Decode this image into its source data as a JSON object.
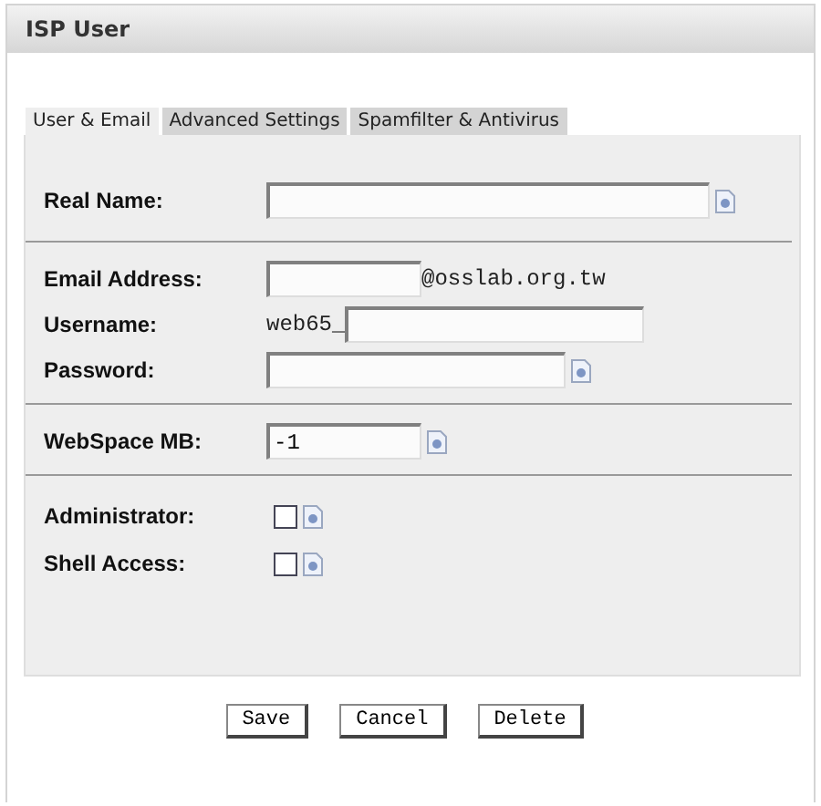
{
  "window": {
    "title": "ISP User"
  },
  "tabs": [
    {
      "label": "User & Email",
      "selected": true
    },
    {
      "label": "Advanced Settings",
      "selected": false
    },
    {
      "label": "Spamfilter & Antivirus",
      "selected": false
    }
  ],
  "sections": [
    {
      "rows": [
        {
          "kind": "text",
          "label": "Real Name:",
          "value": "",
          "help": true
        }
      ]
    },
    {
      "rows": [
        {
          "kind": "suffix",
          "label": "Email Address:",
          "value": "",
          "suffix": "@osslab.org.tw",
          "help": false
        },
        {
          "kind": "prefix",
          "label": "Username:",
          "prefix": "web65_",
          "value": "",
          "help": false
        },
        {
          "kind": "password",
          "label": "Password:",
          "value": "",
          "help": true
        }
      ]
    },
    {
      "rows": [
        {
          "kind": "number",
          "label": "WebSpace MB:",
          "value": "-1",
          "help": true
        }
      ]
    },
    {
      "rows": [
        {
          "kind": "checkbox",
          "label": "Administrator:",
          "checked": false,
          "help": true
        },
        {
          "kind": "checkbox",
          "label": "Shell Access:",
          "checked": false,
          "help": true
        }
      ]
    }
  ],
  "buttons": [
    "Save",
    "Cancel",
    "Delete"
  ]
}
